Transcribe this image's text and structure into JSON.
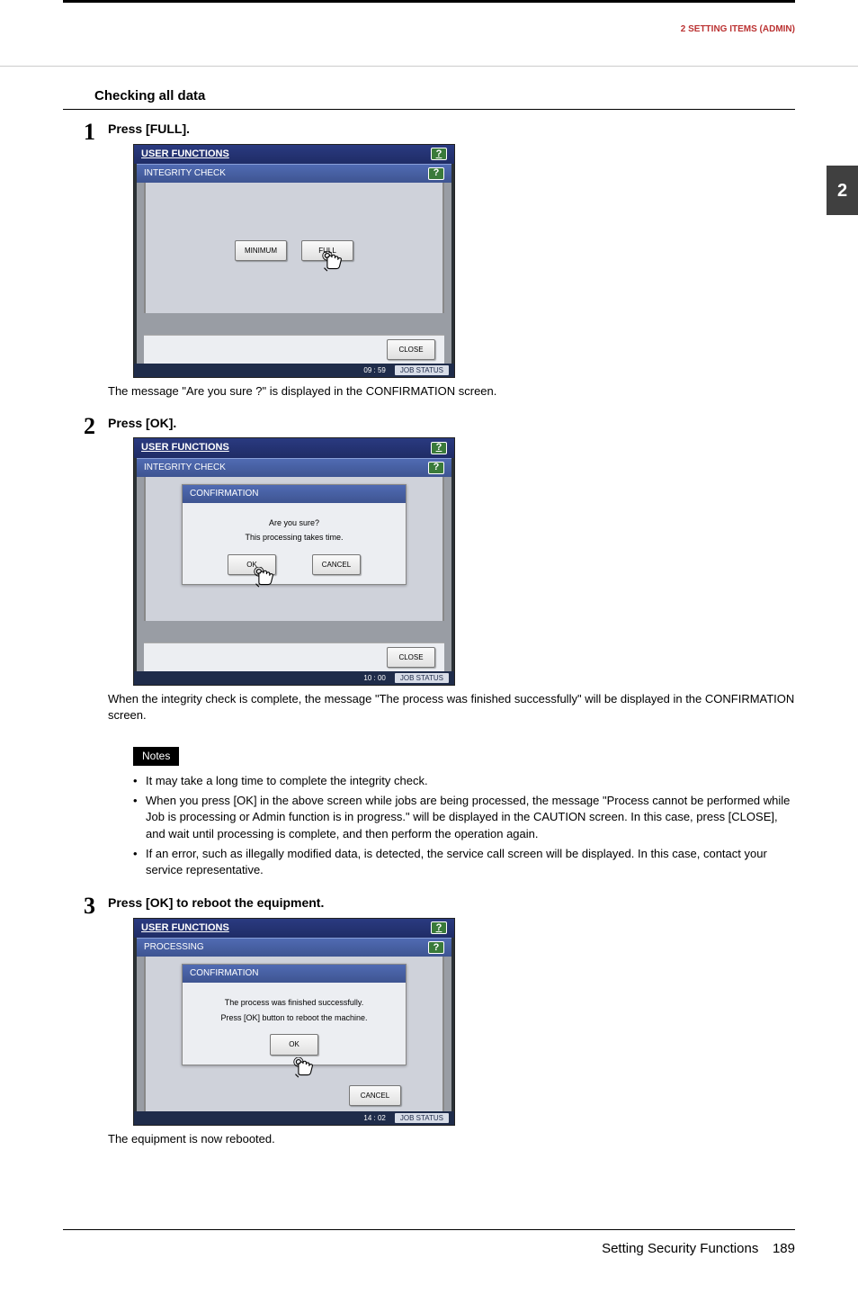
{
  "header": {
    "chapter": "2 SETTING ITEMS (ADMIN)"
  },
  "sideTab": "2",
  "section": {
    "title": "Checking all data"
  },
  "steps": [
    {
      "num": "1",
      "head": "Press [FULL].",
      "text_after": "The message \"Are you sure ?\" is displayed in the CONFIRMATION screen."
    },
    {
      "num": "2",
      "head": "Press [OK].",
      "text_after": "When the integrity check is complete, the message \"The process was finished successfully\" will be displayed in the CONFIRMATION screen."
    },
    {
      "num": "3",
      "head": "Press [OK] to reboot the equipment.",
      "text_after": "The equipment is now rebooted."
    }
  ],
  "notes": {
    "label": "Notes",
    "items": [
      "It may take a long time to complete the integrity check.",
      "When you press [OK] in the above screen while jobs are being processed, the message \"Process cannot be performed while Job is processing or Admin function is in progress.\" will be displayed in the CAUTION screen. In this case, press [CLOSE], and wait until processing is complete, and then perform the operation again.",
      "If an error, such as illegally modified data, is detected, the service call screen will be displayed. In this case, contact your service representative."
    ]
  },
  "screens": {
    "s1": {
      "title": "USER FUNCTIONS",
      "sub": "INTEGRITY CHECK",
      "btn_min": "MINIMUM",
      "btn_full": "FULL",
      "btn_close": "CLOSE",
      "time": "09 : 59",
      "jobstatus": "JOB STATUS"
    },
    "s2": {
      "title": "USER FUNCTIONS",
      "sub": "INTEGRITY CHECK",
      "dialog_title": "CONFIRMATION",
      "line1": "Are you sure?",
      "line2": "This processing takes time.",
      "btn_ok": "OK",
      "btn_cancel": "CANCEL",
      "btn_close": "CLOSE",
      "time": "10 : 00",
      "jobstatus": "JOB STATUS"
    },
    "s3": {
      "title": "USER FUNCTIONS",
      "sub": "PROCESSING",
      "dialog_title": "CONFIRMATION",
      "line1": "The process was finished successfully.",
      "line2": "Press [OK] button to reboot the machine.",
      "btn_ok": "OK",
      "btn_cancel": "CANCEL",
      "time": "14 : 02",
      "jobstatus": "JOB STATUS"
    }
  },
  "footer": {
    "title": "Setting Security Functions",
    "page": "189"
  }
}
